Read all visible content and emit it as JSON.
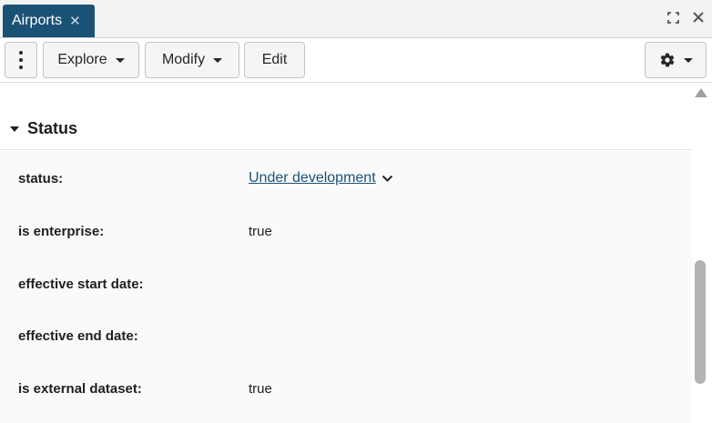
{
  "tab": {
    "title": "Airports",
    "close_glyph": "✕"
  },
  "window_controls": {
    "expand_icon": "expand-icon",
    "close_glyph": "✕"
  },
  "toolbar": {
    "menu_icon": "vertical-dots-icon",
    "explore_label": "Explore",
    "modify_label": "Modify",
    "edit_label": "Edit",
    "settings_icon": "gear-icon"
  },
  "section": {
    "title": "Status",
    "rows": [
      {
        "label": "status:",
        "value": "Under development",
        "is_link": true
      },
      {
        "label": "is enterprise:",
        "value": "true"
      },
      {
        "label": "effective start date:",
        "value": ""
      },
      {
        "label": "effective end date:",
        "value": ""
      },
      {
        "label": "is external dataset:",
        "value": "true"
      }
    ]
  },
  "colors": {
    "tab_bg": "#1a5276",
    "link": "#1a5276"
  }
}
